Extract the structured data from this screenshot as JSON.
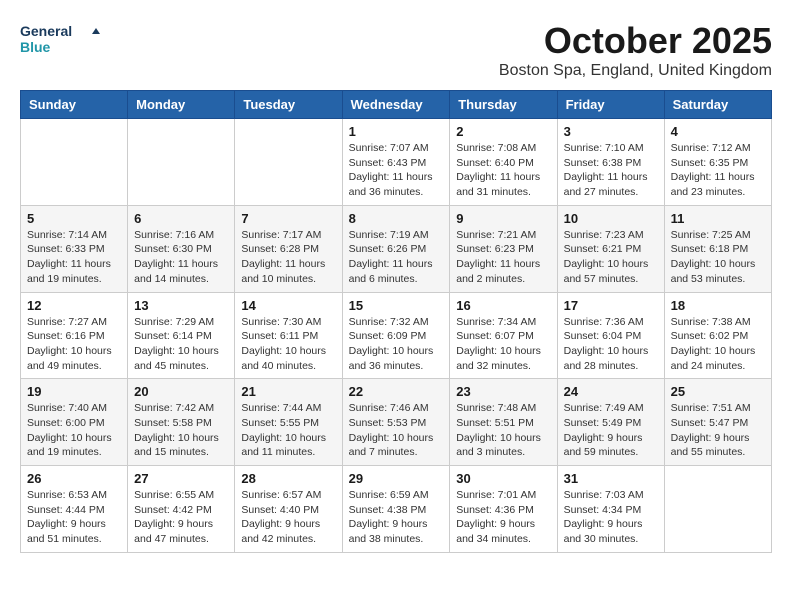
{
  "logo": {
    "line1": "General",
    "line2": "Blue"
  },
  "title": "October 2025",
  "location": "Boston Spa, England, United Kingdom",
  "days_header": [
    "Sunday",
    "Monday",
    "Tuesday",
    "Wednesday",
    "Thursday",
    "Friday",
    "Saturday"
  ],
  "weeks": [
    [
      {
        "day": "",
        "info": ""
      },
      {
        "day": "",
        "info": ""
      },
      {
        "day": "",
        "info": ""
      },
      {
        "day": "1",
        "info": "Sunrise: 7:07 AM\nSunset: 6:43 PM\nDaylight: 11 hours\nand 36 minutes."
      },
      {
        "day": "2",
        "info": "Sunrise: 7:08 AM\nSunset: 6:40 PM\nDaylight: 11 hours\nand 31 minutes."
      },
      {
        "day": "3",
        "info": "Sunrise: 7:10 AM\nSunset: 6:38 PM\nDaylight: 11 hours\nand 27 minutes."
      },
      {
        "day": "4",
        "info": "Sunrise: 7:12 AM\nSunset: 6:35 PM\nDaylight: 11 hours\nand 23 minutes."
      }
    ],
    [
      {
        "day": "5",
        "info": "Sunrise: 7:14 AM\nSunset: 6:33 PM\nDaylight: 11 hours\nand 19 minutes."
      },
      {
        "day": "6",
        "info": "Sunrise: 7:16 AM\nSunset: 6:30 PM\nDaylight: 11 hours\nand 14 minutes."
      },
      {
        "day": "7",
        "info": "Sunrise: 7:17 AM\nSunset: 6:28 PM\nDaylight: 11 hours\nand 10 minutes."
      },
      {
        "day": "8",
        "info": "Sunrise: 7:19 AM\nSunset: 6:26 PM\nDaylight: 11 hours\nand 6 minutes."
      },
      {
        "day": "9",
        "info": "Sunrise: 7:21 AM\nSunset: 6:23 PM\nDaylight: 11 hours\nand 2 minutes."
      },
      {
        "day": "10",
        "info": "Sunrise: 7:23 AM\nSunset: 6:21 PM\nDaylight: 10 hours\nand 57 minutes."
      },
      {
        "day": "11",
        "info": "Sunrise: 7:25 AM\nSunset: 6:18 PM\nDaylight: 10 hours\nand 53 minutes."
      }
    ],
    [
      {
        "day": "12",
        "info": "Sunrise: 7:27 AM\nSunset: 6:16 PM\nDaylight: 10 hours\nand 49 minutes."
      },
      {
        "day": "13",
        "info": "Sunrise: 7:29 AM\nSunset: 6:14 PM\nDaylight: 10 hours\nand 45 minutes."
      },
      {
        "day": "14",
        "info": "Sunrise: 7:30 AM\nSunset: 6:11 PM\nDaylight: 10 hours\nand 40 minutes."
      },
      {
        "day": "15",
        "info": "Sunrise: 7:32 AM\nSunset: 6:09 PM\nDaylight: 10 hours\nand 36 minutes."
      },
      {
        "day": "16",
        "info": "Sunrise: 7:34 AM\nSunset: 6:07 PM\nDaylight: 10 hours\nand 32 minutes."
      },
      {
        "day": "17",
        "info": "Sunrise: 7:36 AM\nSunset: 6:04 PM\nDaylight: 10 hours\nand 28 minutes."
      },
      {
        "day": "18",
        "info": "Sunrise: 7:38 AM\nSunset: 6:02 PM\nDaylight: 10 hours\nand 24 minutes."
      }
    ],
    [
      {
        "day": "19",
        "info": "Sunrise: 7:40 AM\nSunset: 6:00 PM\nDaylight: 10 hours\nand 19 minutes."
      },
      {
        "day": "20",
        "info": "Sunrise: 7:42 AM\nSunset: 5:58 PM\nDaylight: 10 hours\nand 15 minutes."
      },
      {
        "day": "21",
        "info": "Sunrise: 7:44 AM\nSunset: 5:55 PM\nDaylight: 10 hours\nand 11 minutes."
      },
      {
        "day": "22",
        "info": "Sunrise: 7:46 AM\nSunset: 5:53 PM\nDaylight: 10 hours\nand 7 minutes."
      },
      {
        "day": "23",
        "info": "Sunrise: 7:48 AM\nSunset: 5:51 PM\nDaylight: 10 hours\nand 3 minutes."
      },
      {
        "day": "24",
        "info": "Sunrise: 7:49 AM\nSunset: 5:49 PM\nDaylight: 9 hours\nand 59 minutes."
      },
      {
        "day": "25",
        "info": "Sunrise: 7:51 AM\nSunset: 5:47 PM\nDaylight: 9 hours\nand 55 minutes."
      }
    ],
    [
      {
        "day": "26",
        "info": "Sunrise: 6:53 AM\nSunset: 4:44 PM\nDaylight: 9 hours\nand 51 minutes."
      },
      {
        "day": "27",
        "info": "Sunrise: 6:55 AM\nSunset: 4:42 PM\nDaylight: 9 hours\nand 47 minutes."
      },
      {
        "day": "28",
        "info": "Sunrise: 6:57 AM\nSunset: 4:40 PM\nDaylight: 9 hours\nand 42 minutes."
      },
      {
        "day": "29",
        "info": "Sunrise: 6:59 AM\nSunset: 4:38 PM\nDaylight: 9 hours\nand 38 minutes."
      },
      {
        "day": "30",
        "info": "Sunrise: 7:01 AM\nSunset: 4:36 PM\nDaylight: 9 hours\nand 34 minutes."
      },
      {
        "day": "31",
        "info": "Sunrise: 7:03 AM\nSunset: 4:34 PM\nDaylight: 9 hours\nand 30 minutes."
      },
      {
        "day": "",
        "info": ""
      }
    ]
  ]
}
